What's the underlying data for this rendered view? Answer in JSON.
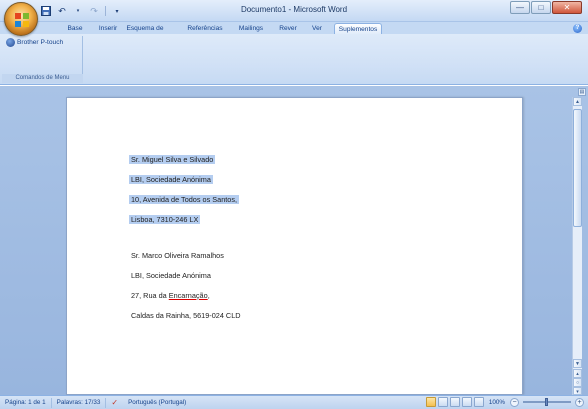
{
  "window": {
    "title": "Documento1 - Microsoft Word",
    "minimize_glyph": "—",
    "maximize_glyph": "□",
    "close_glyph": "✕"
  },
  "quick_access": {
    "save_icon": "save-icon",
    "undo_icon": "undo-icon",
    "redo_icon": "redo-icon",
    "customize_icon": "customize-qat-icon"
  },
  "tabs": [
    {
      "label": "Base"
    },
    {
      "label": "Inserir"
    },
    {
      "label": "Esquema de Página"
    },
    {
      "label": "Referências"
    },
    {
      "label": "Mailings"
    },
    {
      "label": "Rever"
    },
    {
      "label": "Ver"
    },
    {
      "label": "Suplementos"
    }
  ],
  "active_tab": "Suplementos",
  "ribbon": {
    "addin_button": "Brother P-touch",
    "group_label": "Comandos de Menu"
  },
  "document": {
    "block1": [
      "Sr. Miguel Silva e Silvado",
      "LBI, Sociedade Anónima",
      "10, Avenida de Todos os Santos,",
      "Lisboa, 7310-246  LX"
    ],
    "block2": [
      "Sr. Marco Oliveira Ramalhos",
      "LBI, Sociedade Anónima",
      "27, Rua da Encarnação,",
      "Caldas da Rainha, 5619-024  CLD"
    ],
    "block2_line3_prefix": "27, Rua da ",
    "block2_line3_misspelled": "Encarnação",
    "block2_line3_suffix": ","
  },
  "statusbar": {
    "page": "Página: 1 de 1",
    "words": "Palavras: 17/33",
    "language": "Português (Portugal)",
    "zoom": "100%"
  },
  "colors": {
    "selection": "#b4cdf0",
    "ribbon": "#d1e1f6",
    "workspace": "#a9c3e6"
  }
}
